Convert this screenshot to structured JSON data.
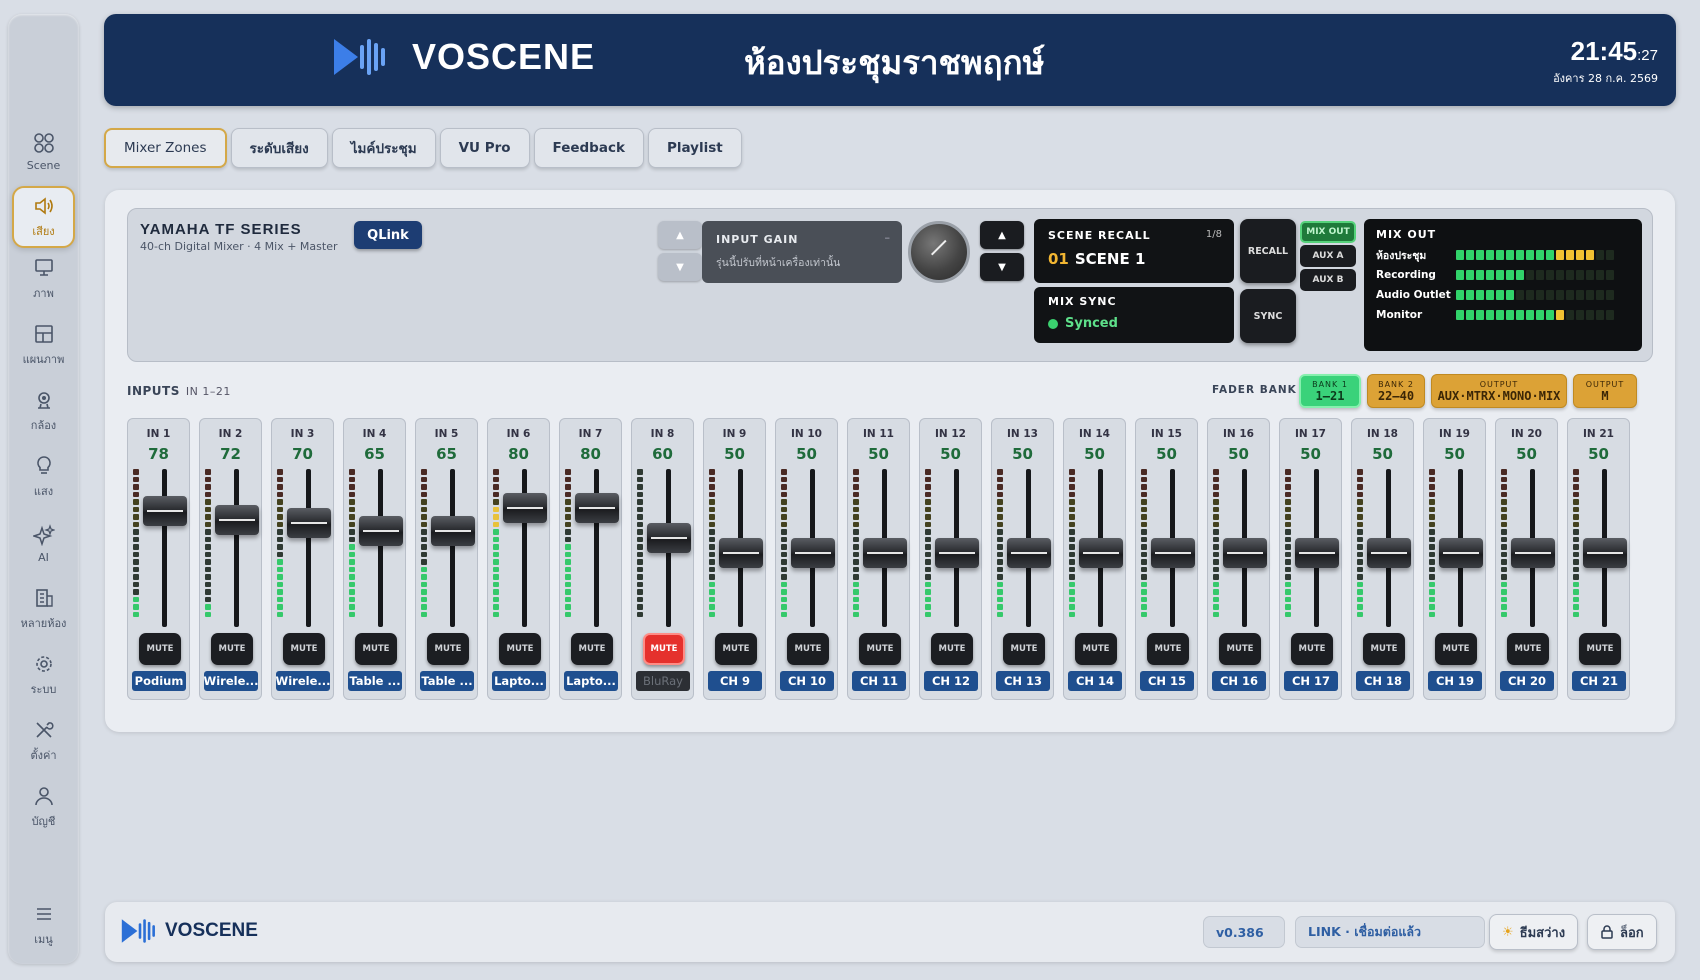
{
  "sidebar": {
    "items": [
      {
        "label": "Scene",
        "icon": "grid-icon"
      },
      {
        "label": "เสียง",
        "icon": "speaker-icon",
        "active": true
      },
      {
        "label": "ภาพ",
        "icon": "monitor-icon"
      },
      {
        "label": "แผนภาพ",
        "icon": "layout-icon"
      },
      {
        "label": "กล้อง",
        "icon": "camera-icon"
      },
      {
        "label": "แสง",
        "icon": "bulb-icon"
      },
      {
        "label": "AI",
        "icon": "sparkle-icon"
      },
      {
        "label": "หลายห้อง",
        "icon": "building-icon"
      },
      {
        "label": "ระบบ",
        "icon": "gear-icon"
      },
      {
        "label": "ตั้งค่า",
        "icon": "tools-icon"
      },
      {
        "label": "บัญชี",
        "icon": "user-icon"
      }
    ],
    "menu_label": "เมนู"
  },
  "header": {
    "brand": "VOSCENE",
    "room": "ห้องประชุมราชพฤกษ์",
    "time": "21:45",
    "seconds": ":27",
    "date": "อังคาร 28 ก.ค. 2569",
    "brand_color": "#16305a"
  },
  "tabs": [
    "Mixer Zones",
    "ระดับเสียง",
    "ไมค์ประชุม",
    "VU Pro",
    "Feedback",
    "Playlist"
  ],
  "mixer": {
    "model": "YAMAHA TF SERIES",
    "desc": "40-ch Digital Mixer · 4 Mix + Master",
    "qlink": "QLink",
    "arrow_up": "▲",
    "arrow_down": "▼",
    "input_gain_title": "INPUT GAIN",
    "input_gain_value": "–",
    "input_gain_note": "รุ่นนี้ปรับที่หน้าเครื่องเท่านั้น",
    "scene_title": "SCENE RECALL",
    "scene_count": "1/8",
    "scene_number": "01",
    "scene_name": "SCENE 1",
    "recall": "RECALL",
    "sync_title": "MIX SYNC",
    "sync_status": "Synced",
    "sync_btn": "SYNC",
    "mix_buttons": [
      "MIX OUT",
      "AUX A",
      "AUX B"
    ],
    "mixout_title": "MIX OUT",
    "mixout_rows": [
      {
        "label": "ห้องประชุม",
        "level": 14
      },
      {
        "label": "Recording",
        "level": 7
      },
      {
        "label": "Audio Outlet",
        "level": 6
      },
      {
        "label": "Monitor",
        "level": 11
      }
    ]
  },
  "inputs": {
    "label": "INPUTS",
    "range": "IN 1–21",
    "fader_bank_label": "FADER BANK",
    "banks": [
      {
        "top": "BANK 1",
        "bottom": "1–21",
        "style": "green"
      },
      {
        "top": "BANK 2",
        "bottom": "22–40",
        "style": "gold"
      },
      {
        "top": "OUTPUT",
        "bottom": "AUX·MTRX·MONO·MIX",
        "style": "gold"
      },
      {
        "top": "OUTPUT",
        "bottom": "M",
        "style": "gold"
      }
    ],
    "mute_label": "MUTE",
    "channels": [
      {
        "name": "IN 1",
        "value": 78,
        "src": "Podium",
        "muted": false,
        "meter": 3
      },
      {
        "name": "IN 2",
        "value": 72,
        "src": "Wirele...",
        "muted": false,
        "meter": 2
      },
      {
        "name": "IN 3",
        "value": 70,
        "src": "Wirele...",
        "muted": false,
        "meter": 8
      },
      {
        "name": "IN 4",
        "value": 65,
        "src": "Table ...",
        "muted": false,
        "meter": 10
      },
      {
        "name": "IN 5",
        "value": 65,
        "src": "Table ...",
        "muted": false,
        "meter": 7
      },
      {
        "name": "IN 6",
        "value": 80,
        "src": "Lapto...",
        "muted": false,
        "meter": 15
      },
      {
        "name": "IN 7",
        "value": 80,
        "src": "Lapto...",
        "muted": false,
        "meter": 10
      },
      {
        "name": "IN 8",
        "value": 60,
        "src": "BluRay",
        "muted": true,
        "meter": 0
      },
      {
        "name": "IN 9",
        "value": 50,
        "src": "CH 9",
        "muted": false,
        "meter": 5
      },
      {
        "name": "IN 10",
        "value": 50,
        "src": "CH 10",
        "muted": false,
        "meter": 5
      },
      {
        "name": "IN 11",
        "value": 50,
        "src": "CH 11",
        "muted": false,
        "meter": 5
      },
      {
        "name": "IN 12",
        "value": 50,
        "src": "CH 12",
        "muted": false,
        "meter": 5
      },
      {
        "name": "IN 13",
        "value": 50,
        "src": "CH 13",
        "muted": false,
        "meter": 5
      },
      {
        "name": "IN 14",
        "value": 50,
        "src": "CH 14",
        "muted": false,
        "meter": 5
      },
      {
        "name": "IN 15",
        "value": 50,
        "src": "CH 15",
        "muted": false,
        "meter": 5
      },
      {
        "name": "IN 16",
        "value": 50,
        "src": "CH 16",
        "muted": false,
        "meter": 5
      },
      {
        "name": "IN 17",
        "value": 50,
        "src": "CH 17",
        "muted": false,
        "meter": 5
      },
      {
        "name": "IN 18",
        "value": 50,
        "src": "CH 18",
        "muted": false,
        "meter": 5
      },
      {
        "name": "IN 19",
        "value": 50,
        "src": "CH 19",
        "muted": false,
        "meter": 5
      },
      {
        "name": "IN 20",
        "value": 50,
        "src": "CH 20",
        "muted": false,
        "meter": 5
      },
      {
        "name": "IN 21",
        "value": 50,
        "src": "CH 21",
        "muted": false,
        "meter": 5
      }
    ]
  },
  "footer": {
    "brand": "VOSCENE",
    "version": "v0.386",
    "link": "LINK · เชื่อมต่อแล้ว",
    "theme": "ธีมสว่าง",
    "lock": "ล็อก"
  }
}
